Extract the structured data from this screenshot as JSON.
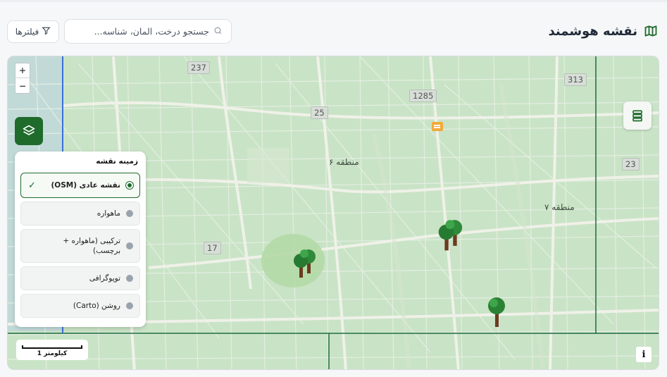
{
  "header": {
    "title": "نقشه هوشمند",
    "title_icon": "map-icon",
    "search_placeholder": "جستجو درخت، المان، شناسه...",
    "search_value": "",
    "filters_label": "فیلترها",
    "accent_color": "#1e6b2b"
  },
  "map": {
    "zoom_in": "+",
    "zoom_out": "−",
    "layers_panel": {
      "title": "زمینه نقشه",
      "selected": "osm",
      "items": [
        {
          "id": "osm",
          "label": "نقشه عادی (OSM)",
          "check": "✓"
        },
        {
          "id": "satellite",
          "label": "ماهواره"
        },
        {
          "id": "hybrid",
          "label": "ترکیبی (ماهواره + برچسب)"
        },
        {
          "id": "topo",
          "label": "توپوگرافی"
        },
        {
          "id": "carto",
          "label": "روشن (Carto)"
        }
      ]
    },
    "scale_label": "1 کیلومتر",
    "info_label": "i",
    "labels": {
      "region6": "منطقه ۶",
      "region7": "منطقه ۷"
    },
    "road_shields": [
      "237",
      "1285",
      "313",
      "25",
      "23",
      "17"
    ]
  }
}
